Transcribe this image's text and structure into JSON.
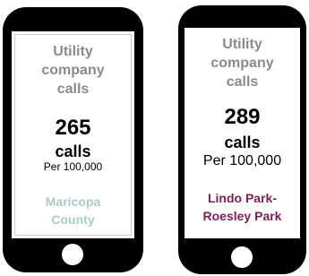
{
  "phones": [
    {
      "heading": [
        "Utility",
        "company",
        "calls"
      ],
      "number": "265",
      "unit": "calls",
      "per": "Per 100,000",
      "place": [
        "Maricopa",
        "County"
      ],
      "place_color": "#a9cbc9"
    },
    {
      "heading": [
        "Utility",
        "company",
        "calls"
      ],
      "number": "289",
      "unit": "calls",
      "per": "Per 100,000",
      "place": [
        "Lindo Park-",
        "Roesley Park"
      ],
      "place_color": "#7d1f57"
    }
  ]
}
